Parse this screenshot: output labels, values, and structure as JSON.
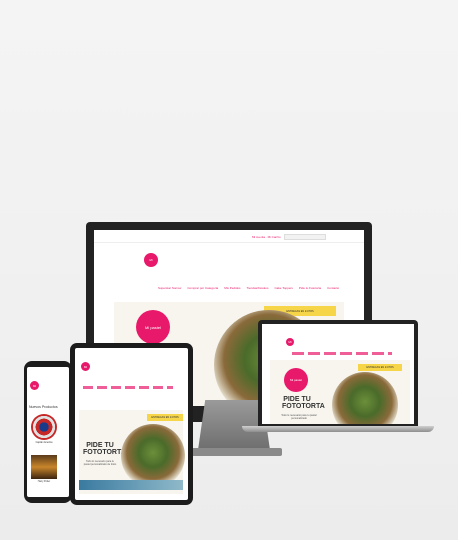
{
  "desktop": {
    "logo_text": "Mi",
    "tag": "ENTREGAS EN 24 HRS",
    "nav": [
      "Superstar Sorrow",
      "Comprar por Categoría",
      "Mis Pedidos",
      "Tiendas/Kioskos",
      "Cake Toppers",
      "Pide tu Fototorta",
      "Contacto"
    ],
    "hero_logo": "Mi pastel",
    "topbar": "Mi cuenta · Mi Carrito"
  },
  "laptop": {
    "logo_text": "Mi",
    "tag": "ENTREGAS EN 24 HRS",
    "hero_logo": "Mi pastel",
    "title_line1": "PIDE TU",
    "title_line2": "FOTOTORTA",
    "body": "Todo lo necesario para tu pastel personalizado"
  },
  "tablet": {
    "logo_text": "Mi",
    "tag": "ENTREGAS EN 24 HRS",
    "title_line1": "PIDE TU",
    "title_line2": "FOTOTORTA",
    "body": "Todo lo necesario para tu pastel personalizado de fotos"
  },
  "phone": {
    "logo_text": "Mi",
    "section_title": "Nuevos Productos",
    "product_1": "Capitán América",
    "product_2": "Harry Potter"
  }
}
